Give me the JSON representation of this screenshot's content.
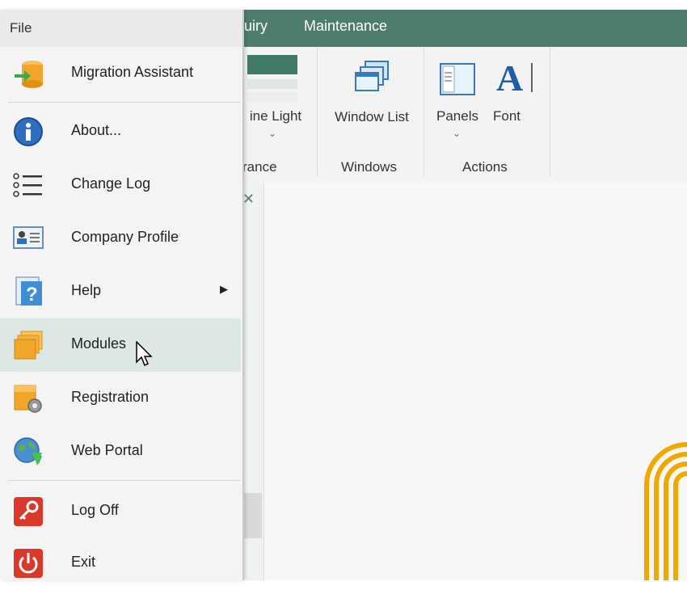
{
  "window": {
    "menubar_tabs": [
      "uiry",
      "Maintenance"
    ]
  },
  "ribbon": {
    "buttons": [
      {
        "label": "ine Light",
        "icon": "theme-icon",
        "has_dropdown": true
      },
      {
        "label": "Window List",
        "icon": "window-list-icon",
        "has_dropdown": true
      },
      {
        "label": "Panels",
        "icon": "panels-icon",
        "has_dropdown": true
      },
      {
        "label": "Font",
        "icon": "font-icon",
        "has_dropdown": false
      }
    ],
    "groups": [
      "rance",
      "Windows",
      "Actions"
    ]
  },
  "file_menu": {
    "title": "File",
    "items": [
      {
        "label": "Migration Assistant",
        "icon": "migration-icon"
      },
      {
        "label": "About...",
        "icon": "info-icon"
      },
      {
        "label": "Change Log",
        "icon": "list-icon"
      },
      {
        "label": "Company Profile",
        "icon": "profile-card-icon"
      },
      {
        "label": "Help",
        "icon": "help-icon",
        "submenu": true
      },
      {
        "label": "Modules",
        "icon": "modules-icon",
        "hovered": true
      },
      {
        "label": "Registration",
        "icon": "registration-icon"
      },
      {
        "label": "Web Portal",
        "icon": "globe-icon"
      },
      {
        "label": "Log Off",
        "icon": "key-icon"
      },
      {
        "label": "Exit",
        "icon": "power-icon"
      }
    ]
  },
  "colors": {
    "menubar": "#4e7d6e",
    "hover": "#dde7e3",
    "logo": "#f0a800"
  }
}
